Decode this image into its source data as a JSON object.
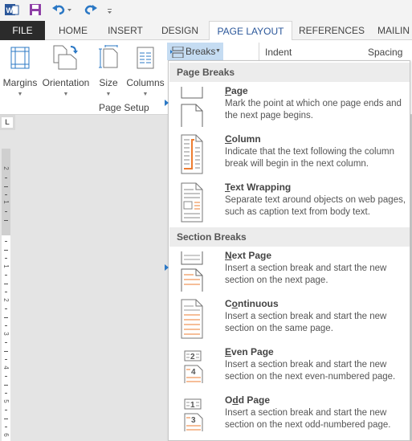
{
  "qat": {
    "app_icon": "word-icon",
    "save_icon": "save-icon",
    "undo_icon": "undo-icon",
    "redo_icon": "redo-icon",
    "customize_icon": "customize-qat-icon"
  },
  "tabs": [
    {
      "label": "FILE"
    },
    {
      "label": "HOME"
    },
    {
      "label": "INSERT"
    },
    {
      "label": "DESIGN"
    },
    {
      "label": "PAGE LAYOUT",
      "active": true
    },
    {
      "label": "REFERENCES"
    },
    {
      "label": "MAILIN"
    }
  ],
  "ribbon": {
    "buttons": [
      {
        "label": "Margins",
        "icon": "margins-icon"
      },
      {
        "label": "Orientation",
        "icon": "orientation-icon"
      },
      {
        "label": "Size",
        "icon": "size-icon"
      },
      {
        "label": "Columns",
        "icon": "columns-icon"
      }
    ],
    "group_label": "Page Setup",
    "breaks_label": "Breaks",
    "indent_label": "Indent",
    "spacing_label": "Spacing"
  },
  "ruler": {
    "corner_glyph": "L",
    "numbers": [
      "2",
      "1",
      "1",
      "2",
      "3",
      "4",
      "5",
      "6"
    ]
  },
  "breaks_menu": {
    "page_breaks_header": "Page Breaks",
    "section_breaks_header": "Section Breaks",
    "page_items": [
      {
        "underline": "P",
        "rest": "age",
        "desc": "Mark the point at which one page ends and the next page begins."
      },
      {
        "underline": "C",
        "rest": "olumn",
        "desc": "Indicate that the text following the column break will begin in the next column."
      },
      {
        "underline": "T",
        "rest": "ext Wrapping",
        "desc": "Separate text around objects on web pages, such as caption text from body text."
      }
    ],
    "section_items": [
      {
        "underline": "N",
        "rest": "ext Page",
        "desc": "Insert a section break and start the new section on the next page."
      },
      {
        "pre": "C",
        "underline": "o",
        "rest": "ntinuous",
        "desc": "Insert a section break and start the new section on the same page."
      },
      {
        "underline": "E",
        "rest": "ven Page",
        "desc": "Insert a section break and start the new section on the next even-numbered page.",
        "top_num": "2",
        "bottom_num": "4"
      },
      {
        "pre": "O",
        "underline": "d",
        "rest": "d Page",
        "desc": "Insert a section break and start the new section on the next odd-numbered page.",
        "top_num": "1",
        "bottom_num": "3"
      }
    ]
  },
  "colors": {
    "accent_blue": "#2b579a",
    "file_tab": "#2b2b2b",
    "highlight": "#c5dcf2",
    "orange": "#ed7d31"
  }
}
